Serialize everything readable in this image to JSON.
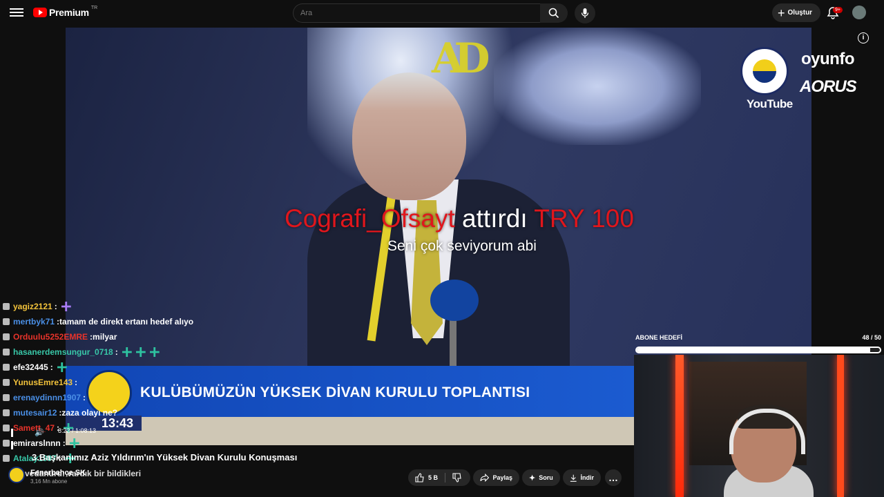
{
  "header": {
    "logo_text": "Premium",
    "logo_region": "TR",
    "search_placeholder": "Ara",
    "create_label": "Oluştur",
    "notifications_badge": "9+"
  },
  "video": {
    "lower_third_title": "KULÜBÜMÜZÜN YÜKSEK DİVAN KURULU TOPLANTISI",
    "clock": "13:43",
    "donation": {
      "name": "Cografi_Ofsayt",
      "middle": " attırdı ",
      "amount": "TRY 100",
      "message": "Seni çok seviyorum abi"
    },
    "sponsor_top_logo": "AD",
    "sponsor_youtube": "YouTube",
    "sponsor_oyunfor": "oyunfo",
    "sponsor_aorus": "AORUS",
    "time_display": "8:22 / 1:08:13"
  },
  "sub_goal": {
    "label": "ABONE HEDEFİ",
    "count": "48 / 50",
    "progress": 0.96
  },
  "chat": [
    {
      "user": "yagiz2121",
      "user_color": "#f3c33b",
      "msg": "",
      "emotes": [
        "purple"
      ]
    },
    {
      "user": "mertbyk71",
      "user_color": "#4a8fe6",
      "msg": "tamam de direkt ertanı hedef alıyo",
      "emotes": []
    },
    {
      "user": "Orduulu5252EMRE",
      "user_color": "#e8332a",
      "msg": "milyar",
      "emotes": []
    },
    {
      "user": "hasanerdemsungur_0718",
      "user_color": "#38c7a8",
      "msg": "",
      "emotes": [
        "teal",
        "teal",
        "teal"
      ]
    },
    {
      "user": "efe32445",
      "user_color": "#ffffff",
      "msg": "",
      "emotes": [
        "teal"
      ]
    },
    {
      "user": "YunusEmre143",
      "user_color": "#f3c33b",
      "msg": "",
      "emotes": []
    },
    {
      "user": "erenaydinnn1907",
      "user_color": "#4a8fe6",
      "msg": "",
      "emotes": []
    },
    {
      "user": "mutesair12",
      "user_color": "#4a8fe6",
      "msg": "zaza olayı ne?",
      "emotes": []
    },
    {
      "user": "Samett_47",
      "user_color": "#e8332a",
      "msg": "",
      "emotes": [
        "teal"
      ]
    },
    {
      "user": "emirarslnnn",
      "user_color": "#ffffff",
      "msg": "",
      "emotes": [
        "teal"
      ]
    },
    {
      "user": "Atalay1907",
      "user_color": "#38c7a8",
      "msg": "",
      "emotes": [
        "teal"
      ]
    }
  ],
  "video_title": "3.Başkanımız Aziz Yıldırım'ın Yüksek Divan Kurulu Konuşması",
  "channel": {
    "name": "Fenerbahçe SK",
    "subs": "3,16 Mn abone"
  },
  "overlay_chat_last": "vedanurd: vardık bir bildikleri",
  "actions": {
    "likes": "5 B",
    "share": "Paylaş",
    "ask": "Soru",
    "download": "İndir",
    "more": "…"
  }
}
